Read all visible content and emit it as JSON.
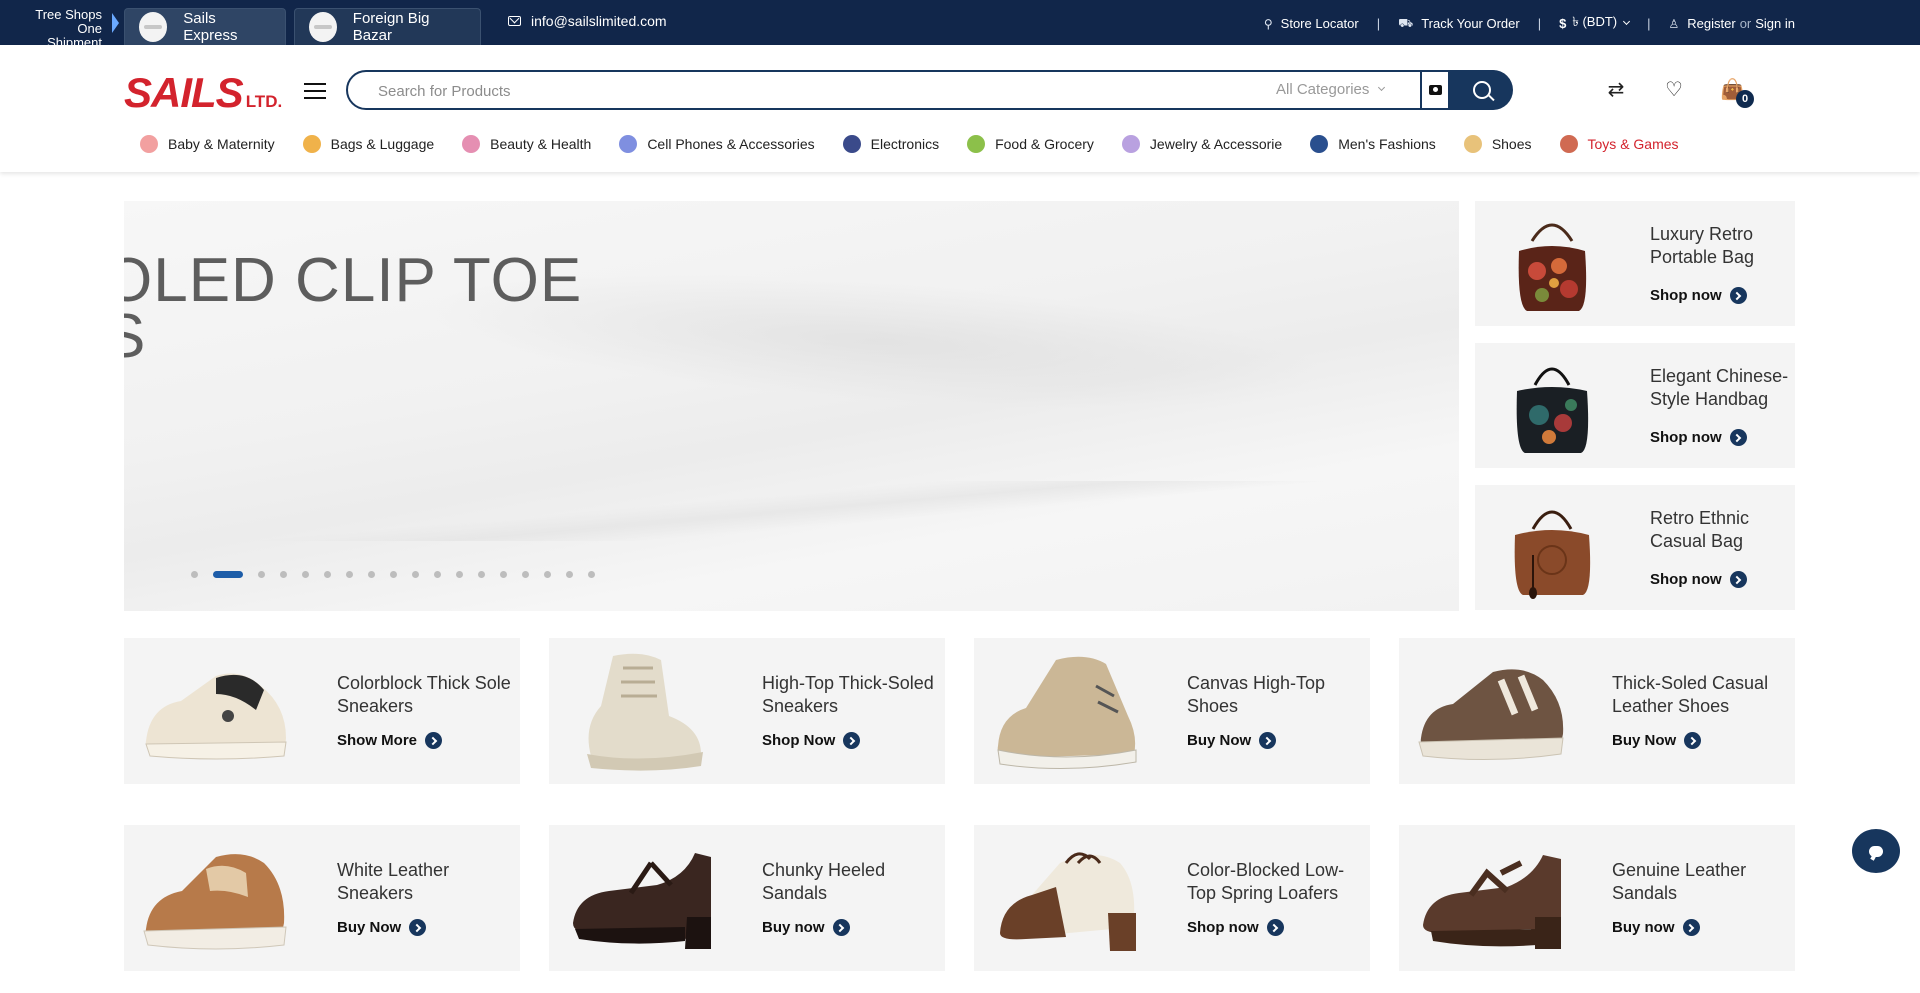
{
  "topbar": {
    "tree_label_line1": "Tree Shops",
    "tree_label_line2": "One Shipment",
    "shop_tabs": [
      {
        "label": "Sails Express"
      },
      {
        "label": "Foreign Big Bazar"
      }
    ],
    "email": "info@sailslimited.com",
    "store_locator": "Store Locator",
    "track_order": "Track Your Order",
    "currency_symbol": "$",
    "currency": "৳ (BDT)",
    "register": "Register",
    "or": "or",
    "sign_in": "Sign in"
  },
  "header": {
    "logo_main": "SAILS",
    "logo_suffix": "LTD.",
    "search_placeholder": "Search for Products",
    "category_select": "All Categories",
    "cart_count": "0"
  },
  "categories": [
    {
      "label": "Baby & Maternity",
      "color": "#f2a0a0"
    },
    {
      "label": "Bags & Luggage",
      "color": "#f0b24a"
    },
    {
      "label": "Beauty & Health",
      "color": "#e58fb2"
    },
    {
      "label": "Cell Phones & Accessories",
      "color": "#7f8fe0"
    },
    {
      "label": "Electronics",
      "color": "#3a4a8a"
    },
    {
      "label": "Food & Grocery",
      "color": "#8cc04a"
    },
    {
      "label": "Jewelry & Accessorie",
      "color": "#b9a1e0"
    },
    {
      "label": "Men's Fashions",
      "color": "#2a4f8e"
    },
    {
      "label": "Shoes",
      "color": "#e8c27a"
    },
    {
      "label": "Toys & Games",
      "color": "#d06a52",
      "active": true
    }
  ],
  "hero": {
    "title": "OLED CLIP TOE\nS",
    "slide_count": 18,
    "active_slide": 2
  },
  "side_promos": [
    {
      "title": "Luxury Retro Portable Bag",
      "cta": "Shop now"
    },
    {
      "title": "Elegant Chinese-Style Handbag",
      "cta": "Shop now"
    },
    {
      "title": "Retro Ethnic Casual Bag",
      "cta": "Shop now"
    }
  ],
  "products": [
    {
      "title": "Colorblock Thick Sole Sneakers",
      "cta": "Show More"
    },
    {
      "title": "High-Top Thick-Soled Sneakers",
      "cta": "Shop Now"
    },
    {
      "title": "Canvas High-Top Shoes",
      "cta": "Buy Now"
    },
    {
      "title": "Thick-Soled Casual Leather Shoes",
      "cta": "Buy Now"
    },
    {
      "title": "White Leather Sneakers",
      "cta": "Buy Now"
    },
    {
      "title": "Chunky Heeled Sandals",
      "cta": "Buy now"
    },
    {
      "title": "Color-Blocked Low-Top Spring Loafers",
      "cta": "Shop now"
    },
    {
      "title": "Genuine Leather Sandals",
      "cta": "Buy now"
    }
  ],
  "colors": {
    "navy": "#11264a",
    "brand_red": "#d3232d",
    "accent_blue": "#1d5da8"
  }
}
